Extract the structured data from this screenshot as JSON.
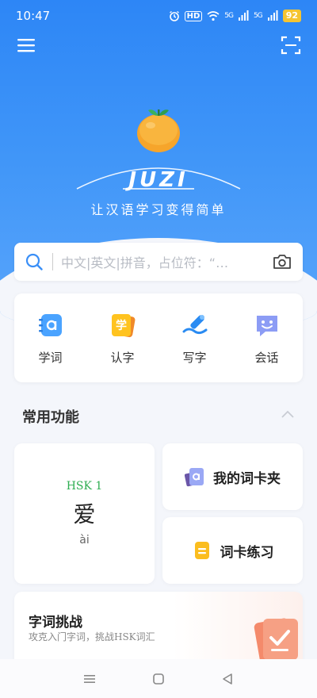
{
  "status": {
    "time": "10:47",
    "hd": "HD",
    "signal1": "5G",
    "signal2": "5G",
    "battery": "92"
  },
  "header": {
    "menu_icon": "menu-icon",
    "scan_icon": "scan-icon"
  },
  "brand": {
    "logo_icon": "orange-fruit-icon",
    "name": "JUZI",
    "slogan": "让汉语学习变得简单"
  },
  "search": {
    "placeholder": "中文|英文|拼音，占位符：“…",
    "search_icon": "search-icon",
    "camera_icon": "camera-icon"
  },
  "quick": [
    {
      "label": "学词",
      "icon": "letter-a-book-icon"
    },
    {
      "label": "认字",
      "icon": "xue-cards-icon"
    },
    {
      "label": "写字",
      "icon": "pen-icon"
    },
    {
      "label": "会话",
      "icon": "chat-smile-icon"
    }
  ],
  "common": {
    "title": "常用功能",
    "collapse_icon": "chevron-up-icon"
  },
  "word_card": {
    "level": "HSK 1",
    "hanzi": "爱",
    "pinyin": "ài"
  },
  "functions": [
    {
      "label": "我的词卡夹",
      "icon": "card-folder-icon"
    },
    {
      "label": "词卡练习",
      "icon": "practice-card-icon"
    }
  ],
  "challenge": {
    "title": "字词挑战",
    "subtitle": "攻克入门字词，挑战HSK词汇",
    "icon": "checklist-icon"
  },
  "navbar": {
    "menu_icon": "recent-apps-icon",
    "home_icon": "home-icon",
    "back_icon": "back-icon"
  },
  "colors": {
    "primary": "#3a8ff7",
    "accent_green": "#2fae52",
    "orange": "#f5a623",
    "battery": "#f5c431"
  }
}
